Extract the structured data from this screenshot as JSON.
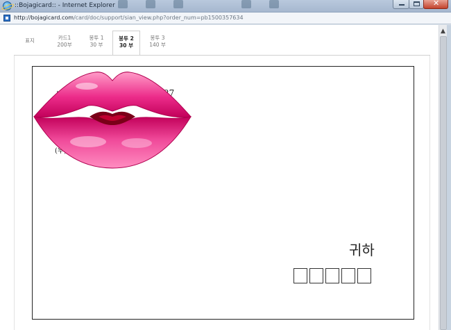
{
  "window": {
    "title": "::Bojagicard:: - Internet Explorer",
    "url_host": "http://bojagicard.com",
    "url_path": "/card/doc/support/sian_view.php?order_num=pb1500357634"
  },
  "tabs": [
    {
      "label": "표지",
      "count": ""
    },
    {
      "label": "카드1",
      "count": "200부"
    },
    {
      "label": "봉투 1",
      "count": "30 부"
    },
    {
      "label": "봉투 2",
      "count": "30 부",
      "active": true
    },
    {
      "label": "봉투 3",
      "count": "140 부"
    }
  ],
  "envelope": {
    "line1_start": "서",
    "line1_end": "27",
    "zip_prefix": "(우)",
    "honorific": "귀하",
    "zip_box_count": 5
  },
  "icons": {
    "browser": "ie-icon",
    "page": "page-icon",
    "sticker": "lips-sticker-icon"
  },
  "colors": {
    "lips": "#ec2c8a",
    "lips_dark": "#b0004f",
    "mouth": "#7a0018",
    "close_button": "#c3432d"
  }
}
